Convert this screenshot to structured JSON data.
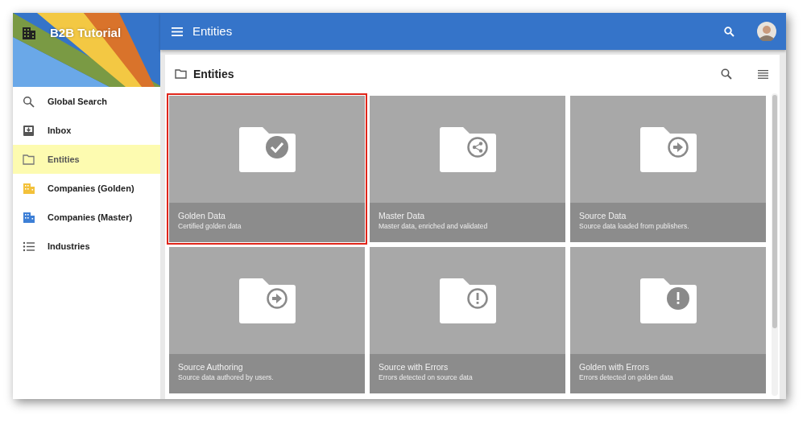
{
  "app": {
    "title": "B2B Tutorial"
  },
  "toolbar": {
    "title": "Entities"
  },
  "sidebar": {
    "items": [
      {
        "label": "Global Search",
        "kind": "search",
        "selected": false
      },
      {
        "label": "Inbox",
        "kind": "inbox",
        "selected": false
      },
      {
        "label": "Entities",
        "kind": "folder",
        "selected": true
      },
      {
        "label": "Companies (Golden)",
        "kind": "building-golden",
        "selected": false
      },
      {
        "label": "Companies (Master)",
        "kind": "building-master",
        "selected": false
      },
      {
        "label": "Industries",
        "kind": "list",
        "selected": false
      }
    ]
  },
  "panel": {
    "title": "Entities"
  },
  "tiles": [
    {
      "title": "Golden Data",
      "subtitle": "Certified golden data",
      "kind": "check",
      "selected": true
    },
    {
      "title": "Master Data",
      "subtitle": "Master data, enriched and validated",
      "kind": "share",
      "selected": false
    },
    {
      "title": "Source Data",
      "subtitle": "Source data loaded from publishers.",
      "kind": "arrow",
      "selected": false
    },
    {
      "title": "Source Authoring",
      "subtitle": "Source data authored by users.",
      "kind": "arrow",
      "selected": false
    },
    {
      "title": "Source with Errors",
      "subtitle": "Errors detected on source data",
      "kind": "alert",
      "selected": false
    },
    {
      "title": "Golden with Errors",
      "subtitle": "Errors detected on golden data",
      "kind": "alert-filled",
      "selected": false
    }
  ]
}
